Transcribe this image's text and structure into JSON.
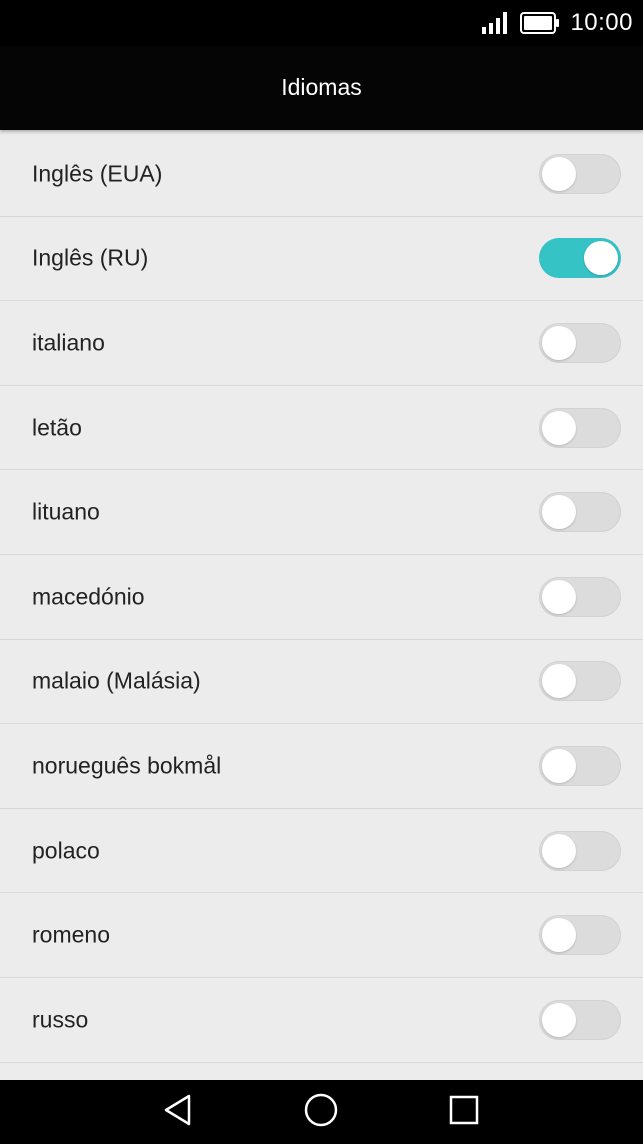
{
  "status_bar": {
    "time": "10:00",
    "signal_icon": "signal-bars-icon",
    "battery_icon": "battery-full-icon"
  },
  "header": {
    "title": "Idiomas"
  },
  "languages": [
    {
      "label": "Inglês (EUA)",
      "enabled": false
    },
    {
      "label": "Inglês (RU)",
      "enabled": true
    },
    {
      "label": "italiano",
      "enabled": false
    },
    {
      "label": "letão",
      "enabled": false
    },
    {
      "label": "lituano",
      "enabled": false
    },
    {
      "label": "macedónio",
      "enabled": false
    },
    {
      "label": "malaio (Malásia)",
      "enabled": false
    },
    {
      "label": "norueguês bokmål",
      "enabled": false
    },
    {
      "label": "polaco",
      "enabled": false
    },
    {
      "label": "romeno",
      "enabled": false
    },
    {
      "label": "russo",
      "enabled": false
    }
  ],
  "nav_bar": {
    "back_icon": "back-triangle-icon",
    "home_icon": "home-circle-icon",
    "recent_icon": "recent-apps-square-icon"
  },
  "colors": {
    "toggle_on": "#36c3c6",
    "toggle_off": "#dcdcdc",
    "background": "#ececec",
    "bars": "#000000"
  }
}
